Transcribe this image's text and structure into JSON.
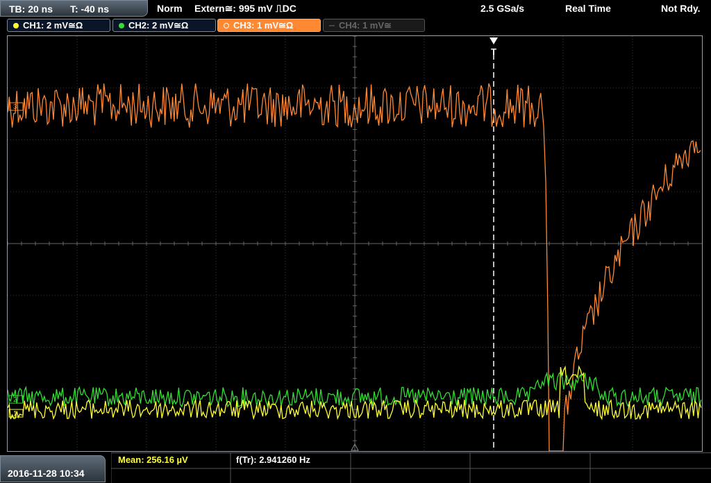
{
  "topbar": {
    "timebase": "TB: 20 ns",
    "trigger_time": "T: -40 ns",
    "acq_mode": "Norm",
    "trigger_info": "Extern≅: 995 mV ⎍DC",
    "sample_rate": "2.5 GSa/s",
    "realtime": "Real Time",
    "status": "Not Rdy."
  },
  "channels": [
    {
      "label": "CH1: 2 mV≅Ω",
      "color": "#ffff33",
      "active": true
    },
    {
      "label": "CH2: 2 mV≅Ω",
      "color": "#33dd33",
      "active": true
    },
    {
      "label": "CH3: 1 mV≅Ω",
      "color": "#ff8833",
      "active": true,
      "selected": true
    },
    {
      "label": "CH4: 1 mV≅",
      "color": "#666666",
      "active": false
    }
  ],
  "markers": {
    "trigger": "T",
    "ch3_ref": "3",
    "ch2_ref": "2",
    "ch1_ref": "1"
  },
  "bottom": {
    "datetime": "2016-11-28 10:34",
    "meas1": "Mean: 256.16 µV",
    "meas2": "f(Tr): 2.941260 Hz"
  },
  "colors": {
    "ch1": "#ffff33",
    "ch2": "#33dd33",
    "ch3": "#ff8833",
    "grid": "#555555"
  }
}
